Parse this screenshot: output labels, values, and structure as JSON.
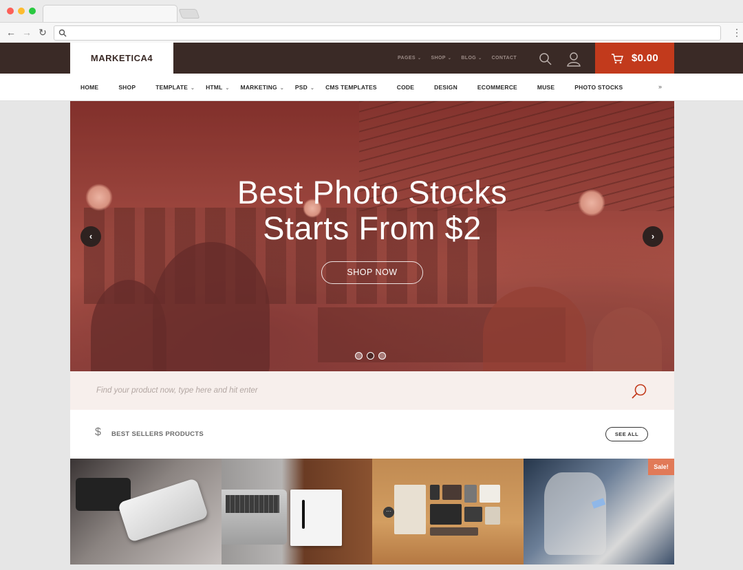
{
  "colors": {
    "header_bg": "#3a2a26",
    "accent": "#c23a1c",
    "sale_badge": "#e17a58",
    "search_strip": "#f7efec"
  },
  "header": {
    "logo": "MARKETICA4",
    "top_links": [
      {
        "label": "PAGES",
        "has_dropdown": true
      },
      {
        "label": "SHOP",
        "has_dropdown": true
      },
      {
        "label": "BLOG",
        "has_dropdown": true
      },
      {
        "label": "CONTACT",
        "has_dropdown": false
      }
    ],
    "cart_total": "$0.00"
  },
  "nav": {
    "items": [
      {
        "label": "HOME",
        "has_dropdown": false
      },
      {
        "label": "SHOP",
        "has_dropdown": false
      },
      {
        "label": "TEMPLATE",
        "has_dropdown": true
      },
      {
        "label": "HTML",
        "has_dropdown": true
      },
      {
        "label": "MARKETING",
        "has_dropdown": true
      },
      {
        "label": "PSD",
        "has_dropdown": true
      },
      {
        "label": "CMS TEMPLATES",
        "has_dropdown": false
      },
      {
        "label": "CODE",
        "has_dropdown": false
      },
      {
        "label": "DESIGN",
        "has_dropdown": false
      },
      {
        "label": "ECOMMERCE",
        "has_dropdown": false
      },
      {
        "label": "MUSE",
        "has_dropdown": false
      },
      {
        "label": "PHOTO STOCKS",
        "has_dropdown": false
      }
    ],
    "more_icon": "double-chevron-down-icon"
  },
  "hero": {
    "title_line1": "Best Photo Stocks",
    "title_line2": "Starts From $2",
    "cta": "SHOP NOW",
    "slides": 3,
    "active_slide": 2
  },
  "search": {
    "placeholder": "Find your product now, type here and hit enter"
  },
  "best_sellers": {
    "title": "BEST SELLERS PRODUCTS",
    "see_all": "SEE ALL"
  },
  "products": [
    {
      "image": "phone-and-camera"
    },
    {
      "image": "laptop-and-notebook"
    },
    {
      "image": "flat-lay-items"
    },
    {
      "image": "person-with-phone",
      "badge": "Sale!"
    }
  ]
}
